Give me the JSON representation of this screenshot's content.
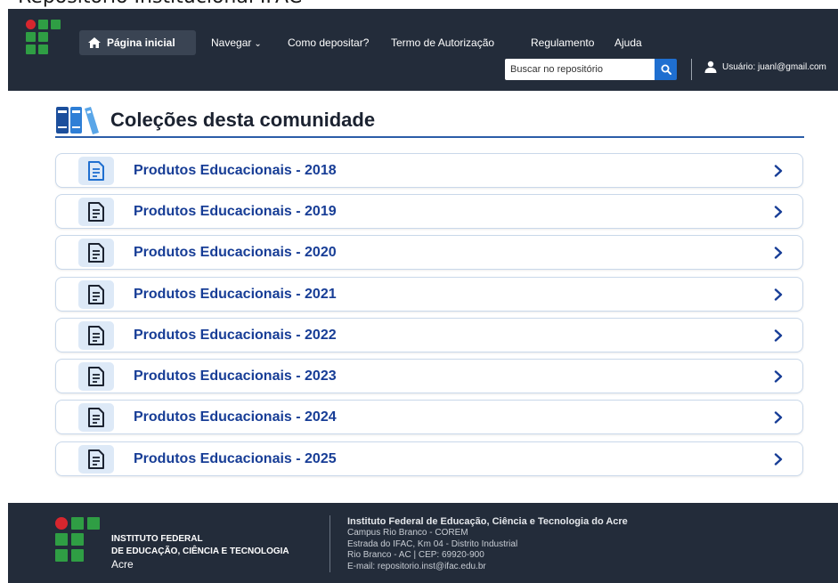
{
  "caption": {
    "text": "Repositório Institucional IFAC"
  },
  "navbar": {
    "items": [
      {
        "label": "Página inicial",
        "active": true
      },
      {
        "label": "Navegar",
        "dropdown": true
      },
      {
        "label": "Como depositar?"
      },
      {
        "label": "Termo de Autorização"
      },
      {
        "label": "Regulamento"
      },
      {
        "label": "Ajuda"
      }
    ],
    "search": {
      "placeholder": "Buscar no repositório"
    },
    "user_label": "Usuário: juanl@gmail.com"
  },
  "section": {
    "title": "Coleções desta comunidade"
  },
  "collections": [
    {
      "title": "Produtos Educacionais - 2018"
    },
    {
      "title": "Produtos Educacionais - 2019"
    },
    {
      "title": "Produtos Educacionais - 2020"
    },
    {
      "title": "Produtos Educacionais - 2021"
    },
    {
      "title": "Produtos Educacionais - 2022"
    },
    {
      "title": "Produtos Educacionais - 2023"
    },
    {
      "title": "Produtos Educacionais - 2024"
    },
    {
      "title": "Produtos Educacionais - 2025"
    }
  ],
  "footer": {
    "org_line1": "INSTITUTO FEDERAL",
    "org_line2": "DE EDUCAÇÃO, CIÊNCIA E TECNOLOGIA",
    "org_line3": "Acre",
    "info_lines": [
      "Instituto Federal de Educação, Ciência e Tecnologia do Acre",
      "Campus Rio Branco - COREM",
      "Estrada do IFAC, Km 04 - Distrito Industrial",
      "Rio Branco - AC | CEP: 69920-900",
      "E-mail: repositorio.inst@ifac.edu.br"
    ]
  },
  "colors": {
    "navbar_bg": "#232c3a",
    "accent_blue": "#1f6fd0",
    "collection_title": "#173d96",
    "logo_green": "#2f9e44",
    "logo_red": "#d7262e"
  },
  "icons": {
    "home": "home-icon",
    "search": "search-icon",
    "user": "user-icon",
    "section": "books-icon",
    "collection": "document-icon",
    "open": "chevron-right-icon"
  }
}
